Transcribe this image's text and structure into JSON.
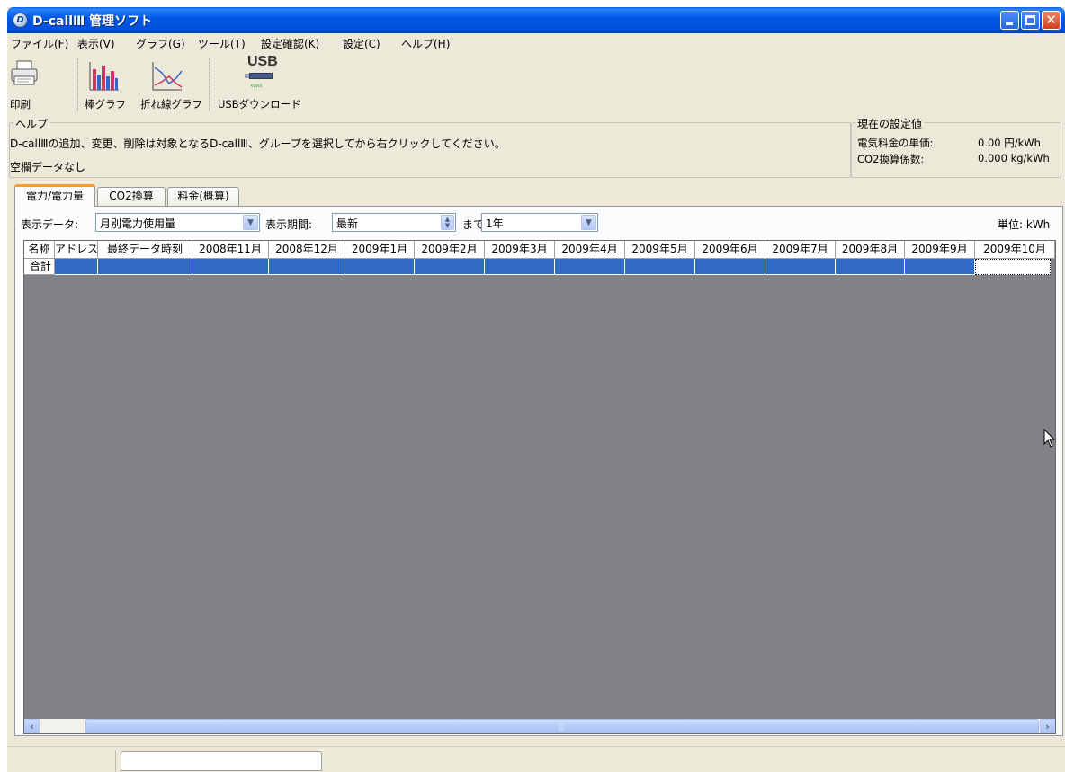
{
  "window": {
    "title": "D-callⅢ 管理ソフト",
    "app_icon_glyph": "D"
  },
  "menu": {
    "items": [
      "ファイル(F)",
      "表示(V)",
      "グラフ(G)",
      "ツール(T)",
      "設定確認(K)",
      "設定(C)",
      "ヘルプ(H)"
    ]
  },
  "toolbar": {
    "print_label": "印刷",
    "bar_chart_label": "棒グラフ",
    "line_chart_label": "折れ線グラフ",
    "usb_download_label": "USBダウンロード",
    "usb_icon_text": "USB"
  },
  "help": {
    "caption": "ヘルプ",
    "text": "D-callⅢの追加、変更、削除は対象となるD-callⅢ、グループを選択してから右クリックしてください。",
    "empty_text": "空欄データなし"
  },
  "settings": {
    "caption": "現在の設定値",
    "unit_price_label": "電気料金の単価:",
    "unit_price_value": "0.00 円/kWh",
    "co2_label": "CO2換算係数:",
    "co2_value": "0.000 kg/kWh"
  },
  "tabs": [
    "電力/電力量",
    "CO2換算",
    "料金(概算)"
  ],
  "filters": {
    "display_data_label": "表示データ:",
    "display_data_value": "月別電力使用量",
    "period_label": "表示期間:",
    "period_value": "最新",
    "until_label": "まで",
    "range_value": "1年",
    "unit_label": "単位: kWh"
  },
  "grid": {
    "columns": [
      "名称",
      "アドレス",
      "最終データ時刻",
      "2008年11月",
      "2008年12月",
      "2009年1月",
      "2009年2月",
      "2009年3月",
      "2009年4月",
      "2009年5月",
      "2009年6月",
      "2009年7月",
      "2009年8月",
      "2009年9月",
      "2009年10月"
    ],
    "row_label": "合計"
  },
  "colors": {
    "title_bar": "#0054e3",
    "selection": "#316ac5",
    "grid_background": "#808285",
    "active_tab_accent": "#ff9a2e"
  }
}
